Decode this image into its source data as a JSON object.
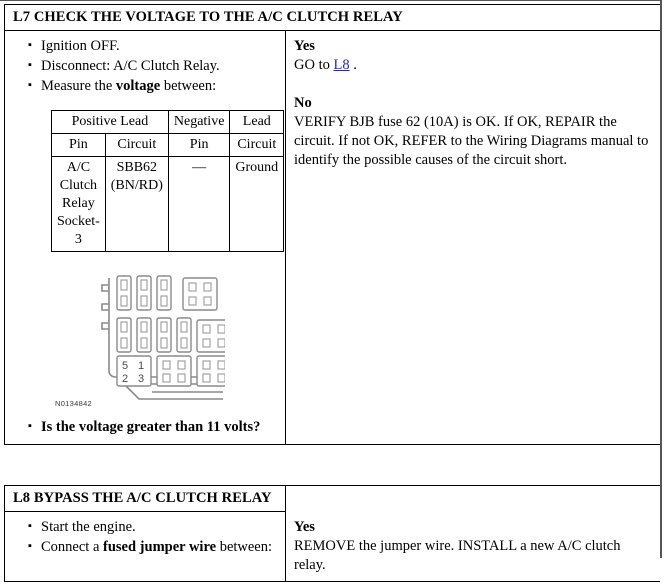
{
  "document": {
    "type": "diagnostic-pinpoint-test"
  },
  "steps": [
    {
      "id": "L7",
      "title": "L7 CHECK THE VOLTAGE TO THE A/C CLUTCH RELAY",
      "bullets": [
        {
          "pre": "Ignition OFF.",
          "bold": "",
          "post": ""
        },
        {
          "pre": "Disconnect: A/C Clutch Relay.",
          "bold": "",
          "post": ""
        },
        {
          "pre": "Measure the ",
          "bold": "voltage",
          "post": " between:"
        }
      ],
      "table": {
        "group_headers": [
          "Positive Lead",
          "Negative",
          "Lead"
        ],
        "column_headers": [
          "Pin",
          "Circuit",
          "Pin",
          "Circuit"
        ],
        "rows": [
          [
            "A/C Clutch Relay Socket-3",
            "SBB62 (BN/RD)",
            "—",
            "Ground"
          ]
        ]
      },
      "figure": {
        "id": "N0134842",
        "pin_labels": [
          "5",
          "1",
          "2",
          "3"
        ]
      },
      "question": "Is the voltage greater than 11 volts?",
      "answers": [
        {
          "label": "Yes",
          "text_before_link": "GO to ",
          "link": "L8",
          "text_after_link": " ."
        },
        {
          "label": "No",
          "text": "VERIFY BJB fuse 62 (10A) is OK. If OK, REPAIR the circuit. If not OK, REFER to the Wiring Diagrams manual to identify the possible causes of the circuit short."
        }
      ]
    },
    {
      "id": "L8",
      "title": "L8 BYPASS THE A/C CLUTCH RELAY",
      "bullets": [
        {
          "pre": "Start the engine.",
          "bold": "",
          "post": ""
        },
        {
          "pre": "Connect a ",
          "bold": "fused jumper wire",
          "post": " between:"
        }
      ],
      "answers": [
        {
          "label": "Yes",
          "text": "REMOVE the jumper wire. INSTALL a new A/C clutch relay."
        }
      ]
    }
  ],
  "colors": {
    "link": "#2222cc",
    "border": "#000000",
    "figure_line": "#808080",
    "text": "#000000"
  }
}
